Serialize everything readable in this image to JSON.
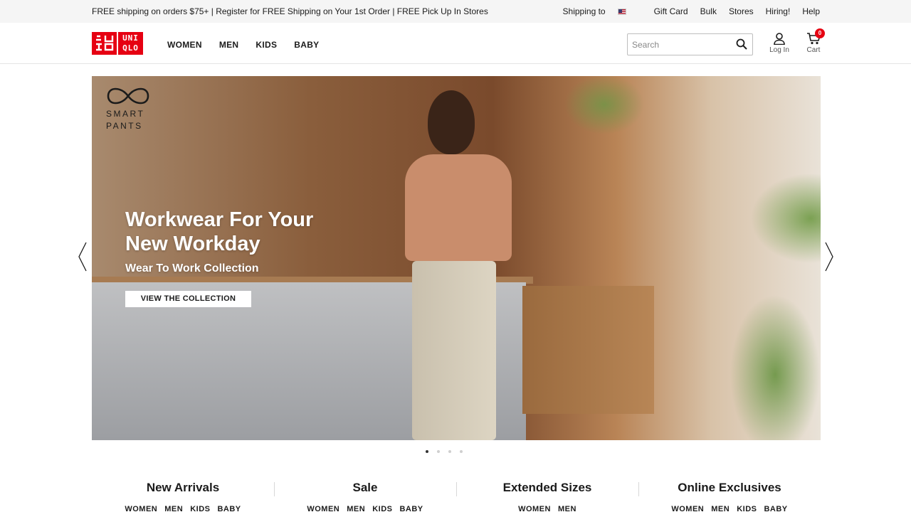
{
  "topbar": {
    "promo": "FREE shipping on orders $75+ | Register for FREE Shipping on Your 1st Order | FREE Pick Up In Stores",
    "shipping_to": "Shipping to",
    "links": [
      "Gift Card",
      "Bulk",
      "Stores",
      "Hiring!",
      "Help"
    ]
  },
  "header": {
    "logo_lines": [
      "UNI",
      "QLO"
    ],
    "nav": [
      "WOMEN",
      "MEN",
      "KIDS",
      "BABY"
    ],
    "search_placeholder": "Search",
    "login_label": "Log In",
    "cart_label": "Cart",
    "cart_count": "0"
  },
  "hero": {
    "badge_line1": "SMART",
    "badge_line2": "PANTS",
    "title": "Workwear For Your New Workday",
    "subtitle": "Wear To Work Collection",
    "cta": "VIEW THE COLLECTION",
    "slide_count": 4,
    "active_slide": 1
  },
  "categories": [
    {
      "title": "New Arrivals",
      "links": [
        "WOMEN",
        "MEN",
        "KIDS",
        "BABY"
      ]
    },
    {
      "title": "Sale",
      "links": [
        "WOMEN",
        "MEN",
        "KIDS",
        "BABY"
      ]
    },
    {
      "title": "Extended Sizes",
      "links": [
        "WOMEN",
        "MEN"
      ]
    },
    {
      "title": "Online Exclusives",
      "links": [
        "WOMEN",
        "MEN",
        "KIDS",
        "BABY"
      ]
    }
  ],
  "colors": {
    "brand_red": "#e60012",
    "text": "#1b1b1b"
  }
}
